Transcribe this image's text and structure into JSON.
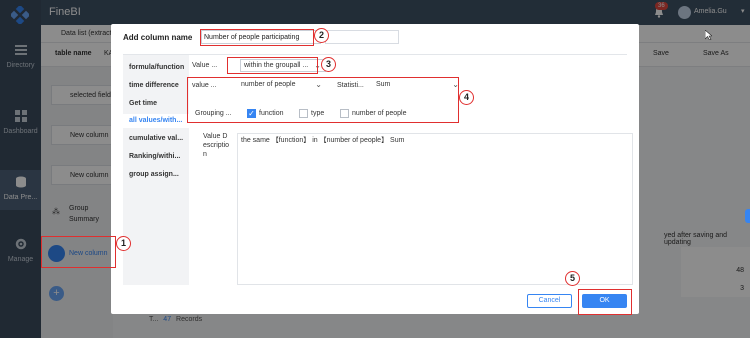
{
  "app": {
    "brand": "FineBI",
    "notif_count": "36",
    "user": "Amelia.Gu"
  },
  "sidebar": [
    {
      "label": "Directory",
      "icon": "directory-icon"
    },
    {
      "label": "Dashboard",
      "icon": "dashboard-icon"
    },
    {
      "label": "Data Pre...",
      "icon": "data-prep-icon"
    },
    {
      "label": "Manage",
      "icon": "manage-icon"
    }
  ],
  "editor": {
    "breadcrumb": "Data list (extract",
    "table_name_label": "table name",
    "table_name_partial": "KA",
    "save": "Save",
    "save_as": "Save As",
    "steps": [
      "selected field",
      "New column",
      "New column",
      "Group Summary",
      "New column"
    ],
    "right_info": "yed after saving and updating",
    "table_values": [
      "48",
      "3"
    ],
    "records_prefix": "T...",
    "records_count": "47",
    "records_label": "Records"
  },
  "dialog": {
    "title": "Add column name",
    "name_value": "Number of people participating",
    "menu": [
      "formula/function",
      "time difference",
      "Get time",
      "all values/with...",
      "cumulative val...",
      "Ranking/withi...",
      "group assign..."
    ],
    "value_label": "Value ...",
    "value_select": "within the groupall ...",
    "value2_label": "value ...",
    "field_select": "number of people",
    "stat_label": "Statisti...",
    "stat_select": "Sum",
    "grouping_label": "Grouping ...",
    "checks": [
      {
        "label": "function",
        "checked": true
      },
      {
        "label": "type",
        "checked": false
      },
      {
        "label": "number of people",
        "checked": false
      }
    ],
    "desc_label_1": "Value D",
    "desc_label_2": "escriptio",
    "desc_label_3": "n",
    "desc_text": "the same 【function】 in 【number of people】 Sum",
    "cancel": "Cancel",
    "ok": "OK"
  },
  "annotations": [
    "1",
    "2",
    "3",
    "4",
    "5"
  ]
}
